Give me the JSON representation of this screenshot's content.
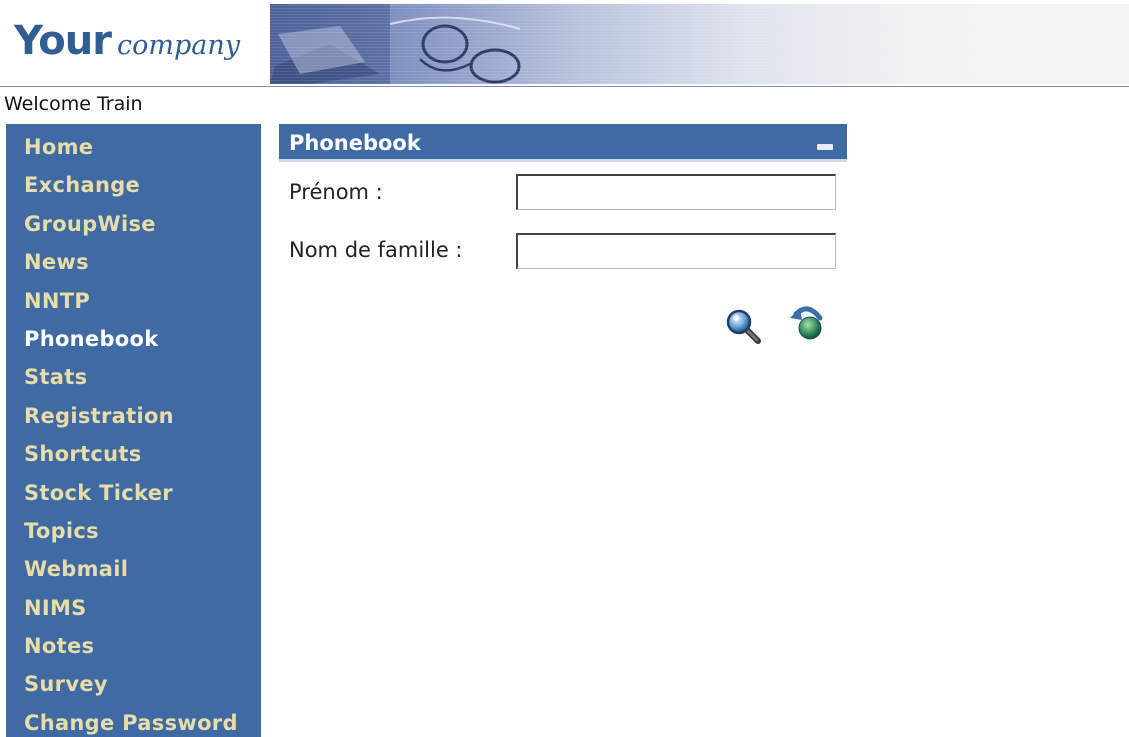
{
  "header": {
    "logo_your": "Your",
    "logo_company": "company"
  },
  "welcome_text": "Welcome Train",
  "sidebar": {
    "items": [
      {
        "label": "Home"
      },
      {
        "label": "Exchange"
      },
      {
        "label": "GroupWise"
      },
      {
        "label": "News"
      },
      {
        "label": "NNTP"
      },
      {
        "label": "Phonebook",
        "active": true
      },
      {
        "label": "Stats"
      },
      {
        "label": "Registration"
      },
      {
        "label": "Shortcuts"
      },
      {
        "label": "Stock Ticker"
      },
      {
        "label": "Topics"
      },
      {
        "label": "Webmail"
      },
      {
        "label": "NIMS"
      },
      {
        "label": "Notes"
      },
      {
        "label": "Survey"
      },
      {
        "label": "Change Password"
      }
    ]
  },
  "portlet": {
    "title": "Phonebook",
    "first_name_label": "Prénom :",
    "first_name_value": "",
    "last_name_label": "Nom de famille :",
    "last_name_value": "",
    "search_icon": "magnifier-icon",
    "back_icon": "back-arrow-globe-icon"
  },
  "colors": {
    "nav_bg": "#3f6aa3",
    "nav_text": "#e8dca8",
    "nav_active_text": "#ffffff",
    "logo": "#2f5d94"
  }
}
